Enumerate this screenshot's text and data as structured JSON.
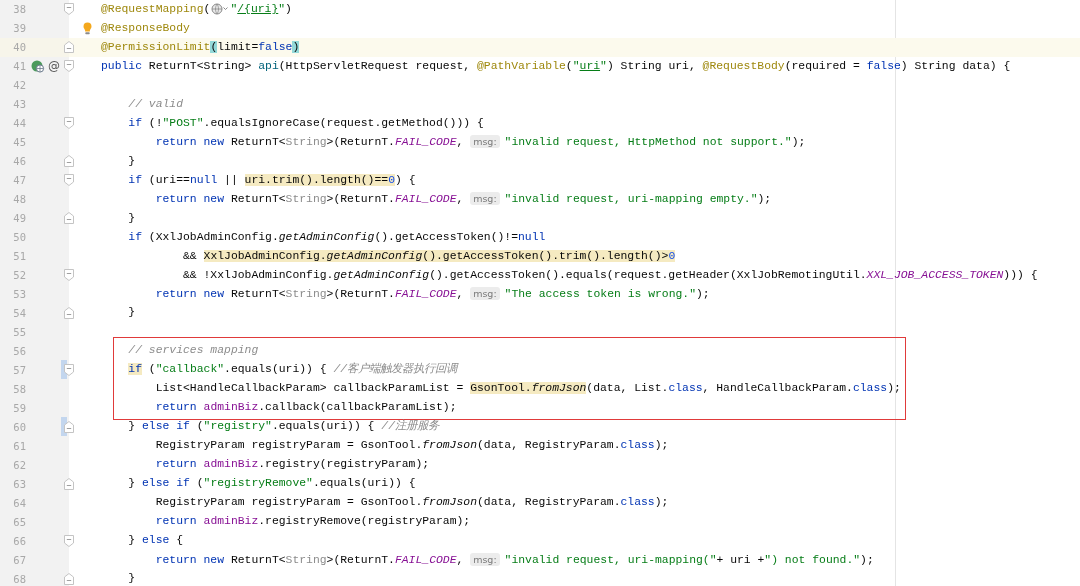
{
  "editor": {
    "blocks": [
      {
        "boxed": false,
        "lines": [
          {
            "number": "38",
            "current": false,
            "fold": {
              "kind": "start"
            },
            "change": false,
            "intention": false,
            "tokens": [
              {
                "kind": "annotation",
                "text": "@RequestMapping"
              },
              {
                "kind": "plain",
                "text": "("
              },
              {
                "kind": "inlay_icon"
              },
              {
                "kind": "string",
                "text": "\""
              },
              {
                "kind": "string",
                "text": "/{uri}",
                "underline": true
              },
              {
                "kind": "string",
                "text": "\""
              },
              {
                "kind": "plain",
                "text": ")"
              }
            ]
          },
          {
            "number": "39",
            "current": false,
            "change": false,
            "intention": true,
            "tokens": [
              {
                "kind": "annotation",
                "text": "@ResponseBody"
              }
            ]
          },
          {
            "number": "40",
            "current": true,
            "fold": {
              "kind": "end"
            },
            "change": false,
            "intention": false,
            "tokens": [
              {
                "kind": "annotation",
                "text": "@PermissionLimit"
              },
              {
                "kind": "plain",
                "text": "(",
                "brace_match": true
              },
              {
                "kind": "plain",
                "text": "limit="
              },
              {
                "kind": "keyword",
                "text": "false"
              },
              {
                "kind": "plain",
                "text": ")",
                "brace_match": true
              }
            ]
          },
          {
            "number": "41",
            "current": false,
            "fold": {
              "kind": "start"
            },
            "change": false,
            "intention": false,
            "gutter": [
              {
                "kind": "endpoint"
              },
              {
                "kind": "mark",
                "text": "@"
              }
            ],
            "tokens": [
              {
                "kind": "keyword",
                "text": "public "
              },
              {
                "kind": "plain",
                "text": "ReturnT<String> "
              },
              {
                "kind": "method",
                "text": "api"
              },
              {
                "kind": "plain",
                "text": "(HttpServletRequest request, "
              },
              {
                "kind": "annotation",
                "text": "@PathVariable"
              },
              {
                "kind": "plain",
                "text": "("
              },
              {
                "kind": "string",
                "text": "\""
              },
              {
                "kind": "string",
                "text": "uri",
                "underline": true
              },
              {
                "kind": "string",
                "text": "\""
              },
              {
                "kind": "plain",
                "text": ") String uri, "
              },
              {
                "kind": "annotation",
                "text": "@RequestBody"
              },
              {
                "kind": "plain",
                "text": "(required = "
              },
              {
                "kind": "keyword",
                "text": "false"
              },
              {
                "kind": "plain",
                "text": ") String data) {"
              }
            ]
          },
          {
            "number": "42",
            "current": false,
            "change": false,
            "intention": false
          },
          {
            "number": "43",
            "current": false,
            "change": false,
            "intention": false,
            "tokens": [
              {
                "kind": "comment",
                "text": "    // valid"
              }
            ]
          },
          {
            "number": "44",
            "current": false,
            "fold": {
              "kind": "start"
            },
            "change": false,
            "intention": false,
            "tokens": [
              {
                "kind": "keyword",
                "text": "    if"
              },
              {
                "kind": "plain",
                "text": " (!"
              },
              {
                "kind": "string",
                "text": "\"POST\""
              },
              {
                "kind": "plain",
                "text": ".equalsIgnoreCase(request.getMethod())) {"
              }
            ]
          },
          {
            "number": "45",
            "current": false,
            "change": false,
            "intention": false,
            "tokens": [
              {
                "kind": "keyword",
                "text": "        return new "
              },
              {
                "kind": "plain",
                "text": "ReturnT<"
              },
              {
                "kind": "muted",
                "text": "String"
              },
              {
                "kind": "plain",
                "text": ">(ReturnT."
              },
              {
                "kind": "constant",
                "text": "FAIL_CODE"
              },
              {
                "kind": "plain",
                "text": ", "
              },
              {
                "kind": "hint",
                "text": "msg:"
              },
              {
                "kind": "string",
                "text": "\"invalid request, HttpMethod not support.\""
              },
              {
                "kind": "plain",
                "text": ");"
              }
            ]
          },
          {
            "number": "46",
            "current": false,
            "fold": {
              "kind": "end"
            },
            "change": false,
            "intention": false,
            "tokens": [
              {
                "kind": "plain",
                "text": "    }"
              }
            ]
          },
          {
            "number": "47",
            "current": false,
            "fold": {
              "kind": "start"
            },
            "change": false,
            "intention": false,
            "tokens": [
              {
                "kind": "keyword",
                "text": "    if"
              },
              {
                "kind": "plain",
                "text": " (uri=="
              },
              {
                "kind": "keyword",
                "text": "null"
              },
              {
                "kind": "plain",
                "text": " || "
              },
              {
                "kind": "plain",
                "text": "uri.trim().length()==",
                "usage_highlight": true
              },
              {
                "kind": "number",
                "text": "0",
                "usage_highlight": true
              },
              {
                "kind": "plain",
                "text": ") {"
              }
            ]
          },
          {
            "number": "48",
            "current": false,
            "change": false,
            "intention": false,
            "tokens": [
              {
                "kind": "keyword",
                "text": "        return new "
              },
              {
                "kind": "plain",
                "text": "ReturnT<"
              },
              {
                "kind": "muted",
                "text": "String"
              },
              {
                "kind": "plain",
                "text": ">(ReturnT."
              },
              {
                "kind": "constant",
                "text": "FAIL_CODE"
              },
              {
                "kind": "plain",
                "text": ", "
              },
              {
                "kind": "hint",
                "text": "msg:"
              },
              {
                "kind": "string",
                "text": "\"invalid request, uri-mapping empty.\""
              },
              {
                "kind": "plain",
                "text": ");"
              }
            ]
          },
          {
            "number": "49",
            "current": false,
            "fold": {
              "kind": "end"
            },
            "change": false,
            "intention": false,
            "tokens": [
              {
                "kind": "plain",
                "text": "    }"
              }
            ]
          },
          {
            "number": "50",
            "current": false,
            "change": false,
            "intention": false,
            "tokens": [
              {
                "kind": "keyword",
                "text": "    if"
              },
              {
                "kind": "plain",
                "text": " (XxlJobAdminConfig."
              },
              {
                "kind": "static",
                "text": "getAdminConfig"
              },
              {
                "kind": "plain",
                "text": "().getAccessToken()!="
              },
              {
                "kind": "keyword",
                "text": "null"
              }
            ]
          },
          {
            "number": "51",
            "current": false,
            "change": false,
            "intention": false,
            "tokens": [
              {
                "kind": "plain",
                "text": "            && "
              },
              {
                "kind": "plain",
                "text": "XxlJobAdminConfig.",
                "usage_highlight": true
              },
              {
                "kind": "static",
                "text": "getAdminConfig",
                "usage_highlight": true
              },
              {
                "kind": "plain",
                "text": "().getAccessToken().trim().length()>",
                "usage_highlight": true
              },
              {
                "kind": "number",
                "text": "0",
                "usage_highlight": true
              }
            ]
          },
          {
            "number": "52",
            "current": false,
            "fold": {
              "kind": "start"
            },
            "change": false,
            "intention": false,
            "tokens": [
              {
                "kind": "plain",
                "text": "            && !XxlJobAdminConfig."
              },
              {
                "kind": "static",
                "text": "getAdminConfig"
              },
              {
                "kind": "plain",
                "text": "().getAccessToken().equals(request.getHeader(XxlJobRemotingUtil."
              },
              {
                "kind": "constant",
                "text": "XXL_JOB_ACCESS_TOKEN"
              },
              {
                "kind": "plain",
                "text": "))) {"
              }
            ]
          },
          {
            "number": "53",
            "current": false,
            "change": false,
            "intention": false,
            "tokens": [
              {
                "kind": "keyword",
                "text": "        return new "
              },
              {
                "kind": "plain",
                "text": "ReturnT<"
              },
              {
                "kind": "muted",
                "text": "String"
              },
              {
                "kind": "plain",
                "text": ">(ReturnT."
              },
              {
                "kind": "constant",
                "text": "FAIL_CODE"
              },
              {
                "kind": "plain",
                "text": ", "
              },
              {
                "kind": "hint",
                "text": "msg:"
              },
              {
                "kind": "string",
                "text": "\"The access token is wrong.\""
              },
              {
                "kind": "plain",
                "text": ");"
              }
            ]
          },
          {
            "number": "54",
            "current": false,
            "fold": {
              "kind": "end"
            },
            "change": false,
            "intention": false,
            "tokens": [
              {
                "kind": "plain",
                "text": "    }"
              }
            ]
          },
          {
            "number": "55",
            "current": false,
            "change": false,
            "intention": false
          }
        ]
      },
      {
        "boxed": true,
        "lines": [
          {
            "number": "56",
            "current": false,
            "change": false,
            "intention": false,
            "tokens": [
              {
                "kind": "comment",
                "text": "    // services mapping"
              }
            ]
          },
          {
            "number": "57",
            "current": false,
            "fold": {
              "kind": "start"
            },
            "change": true,
            "intention": false,
            "tokens": [
              {
                "kind": "keyword",
                "text": "    if",
                "usage_highlight": true
              },
              {
                "kind": "plain",
                "text": " ("
              },
              {
                "kind": "string",
                "text": "\"callback\""
              },
              {
                "kind": "plain",
                "text": ".equals(uri)) { "
              },
              {
                "kind": "comment",
                "text": "//客户端触发器执行回调"
              }
            ]
          },
          {
            "number": "58",
            "current": false,
            "change": false,
            "intention": false,
            "tokens": [
              {
                "kind": "plain",
                "text": "        List<HandleCallbackParam> callbackParamList = "
              },
              {
                "kind": "plain",
                "text": "GsonTool.",
                "usage_highlight": true
              },
              {
                "kind": "static",
                "text": "fromJson",
                "usage_highlight": true
              },
              {
                "kind": "plain",
                "text": "(data, List."
              },
              {
                "kind": "keyword",
                "text": "class"
              },
              {
                "kind": "plain",
                "text": ", HandleCallbackParam."
              },
              {
                "kind": "keyword",
                "text": "class"
              },
              {
                "kind": "plain",
                "text": ");"
              }
            ]
          },
          {
            "number": "59",
            "current": false,
            "change": false,
            "intention": false,
            "tokens": [
              {
                "kind": "keyword",
                "text": "        return "
              },
              {
                "kind": "field",
                "text": "adminBiz"
              },
              {
                "kind": "plain",
                "text": ".callback(callbackParamList);"
              }
            ]
          }
        ]
      },
      {
        "boxed": false,
        "lines": [
          {
            "number": "60",
            "current": false,
            "fold": {
              "kind": "end"
            },
            "change": true,
            "intention": false,
            "tokens": [
              {
                "kind": "plain",
                "text": "    } "
              },
              {
                "kind": "keyword",
                "text": "else if"
              },
              {
                "kind": "plain",
                "text": " ("
              },
              {
                "kind": "string",
                "text": "\"registry\""
              },
              {
                "kind": "plain",
                "text": ".equals(uri)) { "
              },
              {
                "kind": "comment",
                "text": "//注册服务"
              }
            ]
          },
          {
            "number": "61",
            "current": false,
            "change": false,
            "intention": false,
            "tokens": [
              {
                "kind": "plain",
                "text": "        RegistryParam registryParam = GsonTool."
              },
              {
                "kind": "static",
                "text": "fromJson"
              },
              {
                "kind": "plain",
                "text": "(data, RegistryParam."
              },
              {
                "kind": "keyword",
                "text": "class"
              },
              {
                "kind": "plain",
                "text": ");"
              }
            ]
          },
          {
            "number": "62",
            "current": false,
            "change": false,
            "intention": false,
            "tokens": [
              {
                "kind": "keyword",
                "text": "        return "
              },
              {
                "kind": "field",
                "text": "adminBiz"
              },
              {
                "kind": "plain",
                "text": ".registry(registryParam);"
              }
            ]
          },
          {
            "number": "63",
            "current": false,
            "fold": {
              "kind": "end"
            },
            "change": false,
            "intention": false,
            "tokens": [
              {
                "kind": "plain",
                "text": "    } "
              },
              {
                "kind": "keyword",
                "text": "else if"
              },
              {
                "kind": "plain",
                "text": " ("
              },
              {
                "kind": "string",
                "text": "\"registryRemove\""
              },
              {
                "kind": "plain",
                "text": ".equals(uri)) {"
              }
            ]
          },
          {
            "number": "64",
            "current": false,
            "change": false,
            "intention": false,
            "tokens": [
              {
                "kind": "plain",
                "text": "        RegistryParam registryParam = GsonTool."
              },
              {
                "kind": "static",
                "text": "fromJson"
              },
              {
                "kind": "plain",
                "text": "(data, RegistryParam."
              },
              {
                "kind": "keyword",
                "text": "class"
              },
              {
                "kind": "plain",
                "text": ");"
              }
            ]
          },
          {
            "number": "65",
            "current": false,
            "change": false,
            "intention": false,
            "tokens": [
              {
                "kind": "keyword",
                "text": "        return "
              },
              {
                "kind": "field",
                "text": "adminBiz"
              },
              {
                "kind": "plain",
                "text": ".registryRemove(registryParam);"
              }
            ]
          },
          {
            "number": "66",
            "current": false,
            "fold": {
              "kind": "start"
            },
            "change": false,
            "intention": false,
            "tokens": [
              {
                "kind": "plain",
                "text": "    } "
              },
              {
                "kind": "keyword",
                "text": "else"
              },
              {
                "kind": "plain",
                "text": " {"
              }
            ]
          },
          {
            "number": "67",
            "current": false,
            "change": false,
            "intention": false,
            "tokens": [
              {
                "kind": "keyword",
                "text": "        return new "
              },
              {
                "kind": "plain",
                "text": "ReturnT<"
              },
              {
                "kind": "muted",
                "text": "String"
              },
              {
                "kind": "plain",
                "text": ">(ReturnT."
              },
              {
                "kind": "constant",
                "text": "FAIL_CODE"
              },
              {
                "kind": "plain",
                "text": ", "
              },
              {
                "kind": "hint",
                "text": "msg:"
              },
              {
                "kind": "string",
                "text": "\"invalid request, uri-mapping(\""
              },
              {
                "kind": "plain",
                "text": "+ uri +"
              },
              {
                "kind": "string",
                "text": "\") not found.\""
              },
              {
                "kind": "plain",
                "text": ");"
              }
            ]
          },
          {
            "number": "68",
            "current": false,
            "fold": {
              "kind": "end"
            },
            "change": false,
            "intention": false,
            "tokens": [
              {
                "kind": "plain",
                "text": "    }"
              }
            ]
          }
        ]
      }
    ]
  }
}
